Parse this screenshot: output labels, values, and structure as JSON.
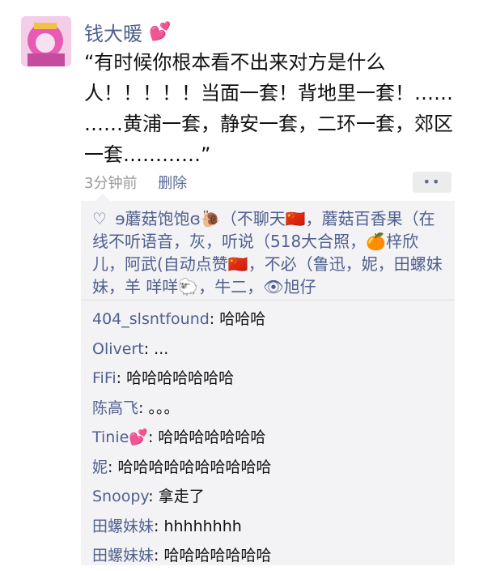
{
  "post": {
    "author": "钱大暖",
    "author_emoji": "💕",
    "text": "“有时候你根本看不出来对方是什么人！！！！！当面一套！背地里一套！……  ……黄浦一套，静安一套，二环一套，郊区一套…………”",
    "time": "3分钟前",
    "delete_label": "删除",
    "more_label": "••"
  },
  "likes": {
    "text": "ɘ蘑菇饱饱ɞ🐌（不聊天🇨🇳，蘑菇百香果（在线不听语音，灰，听说（518大合照，🍊梓欣儿，阿武(自动点赞🇨🇳，不必（鲁迅，妮，田螺妹妹，羊 咩咩🐑，牛二，👁旭仔"
  },
  "comments": [
    {
      "author": "404_slsntfound",
      "text": ": 哈哈哈"
    },
    {
      "author": "Olivert",
      "text": ": ..."
    },
    {
      "author": "FiFi",
      "text": ": 哈哈哈哈哈哈哈"
    },
    {
      "author": "陈高飞",
      "text": ": 。。。"
    },
    {
      "author": "Tinie💕",
      "text": ": 哈哈哈哈哈哈哈"
    },
    {
      "author": "妮",
      "text": ": 哈哈哈哈哈哈哈哈哈哈"
    },
    {
      "author": "Snoopy",
      "text": ": 拿走了"
    },
    {
      "author": "田螺妹妹",
      "text": ": hhhhhhhh"
    },
    {
      "author": "田螺妹妹",
      "text": ": 哈哈哈哈哈哈哈"
    }
  ]
}
